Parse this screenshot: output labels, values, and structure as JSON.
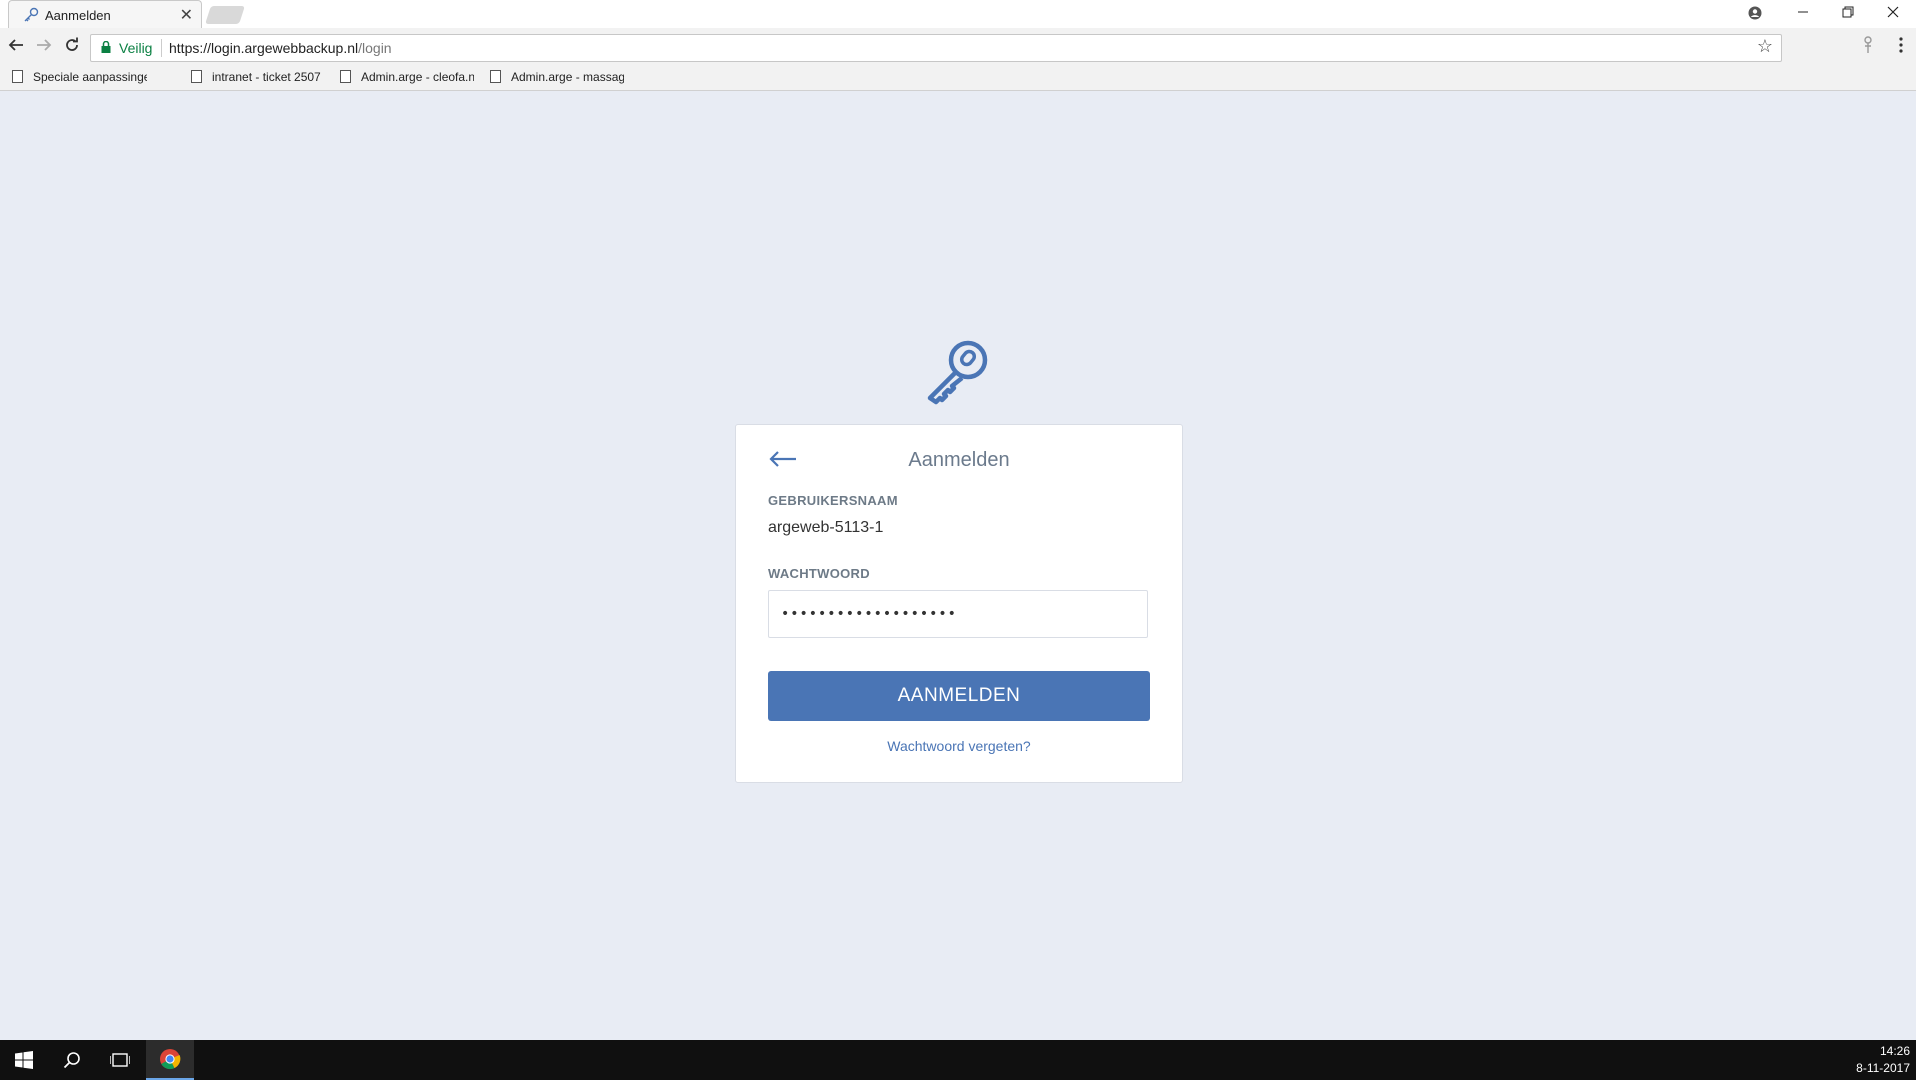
{
  "browser": {
    "tab_title": "Aanmelden",
    "tab_close": "✕",
    "secure_label": "Veilig",
    "url_host": "https://login.argewebbackup.nl",
    "url_path": "/login",
    "bookmarks": [
      "Speciale aanpassinge",
      "intranet - ticket 2507",
      "Admin.arge - cleofa.n",
      "Admin.arge - massag"
    ]
  },
  "login": {
    "title": "Aanmelden",
    "username_label": "GEBRUIKERSNAAM",
    "username_value": "argeweb-5113-1",
    "password_label": "WACHTWOORD",
    "password_value": "•••••••••••••••••••",
    "submit_label": "AANMELDEN",
    "forgot_link": "Wachtwoord vergeten?",
    "accent_color": "#4a75b5"
  },
  "taskbar": {
    "time": "14:26",
    "date": "8-11-2017"
  }
}
